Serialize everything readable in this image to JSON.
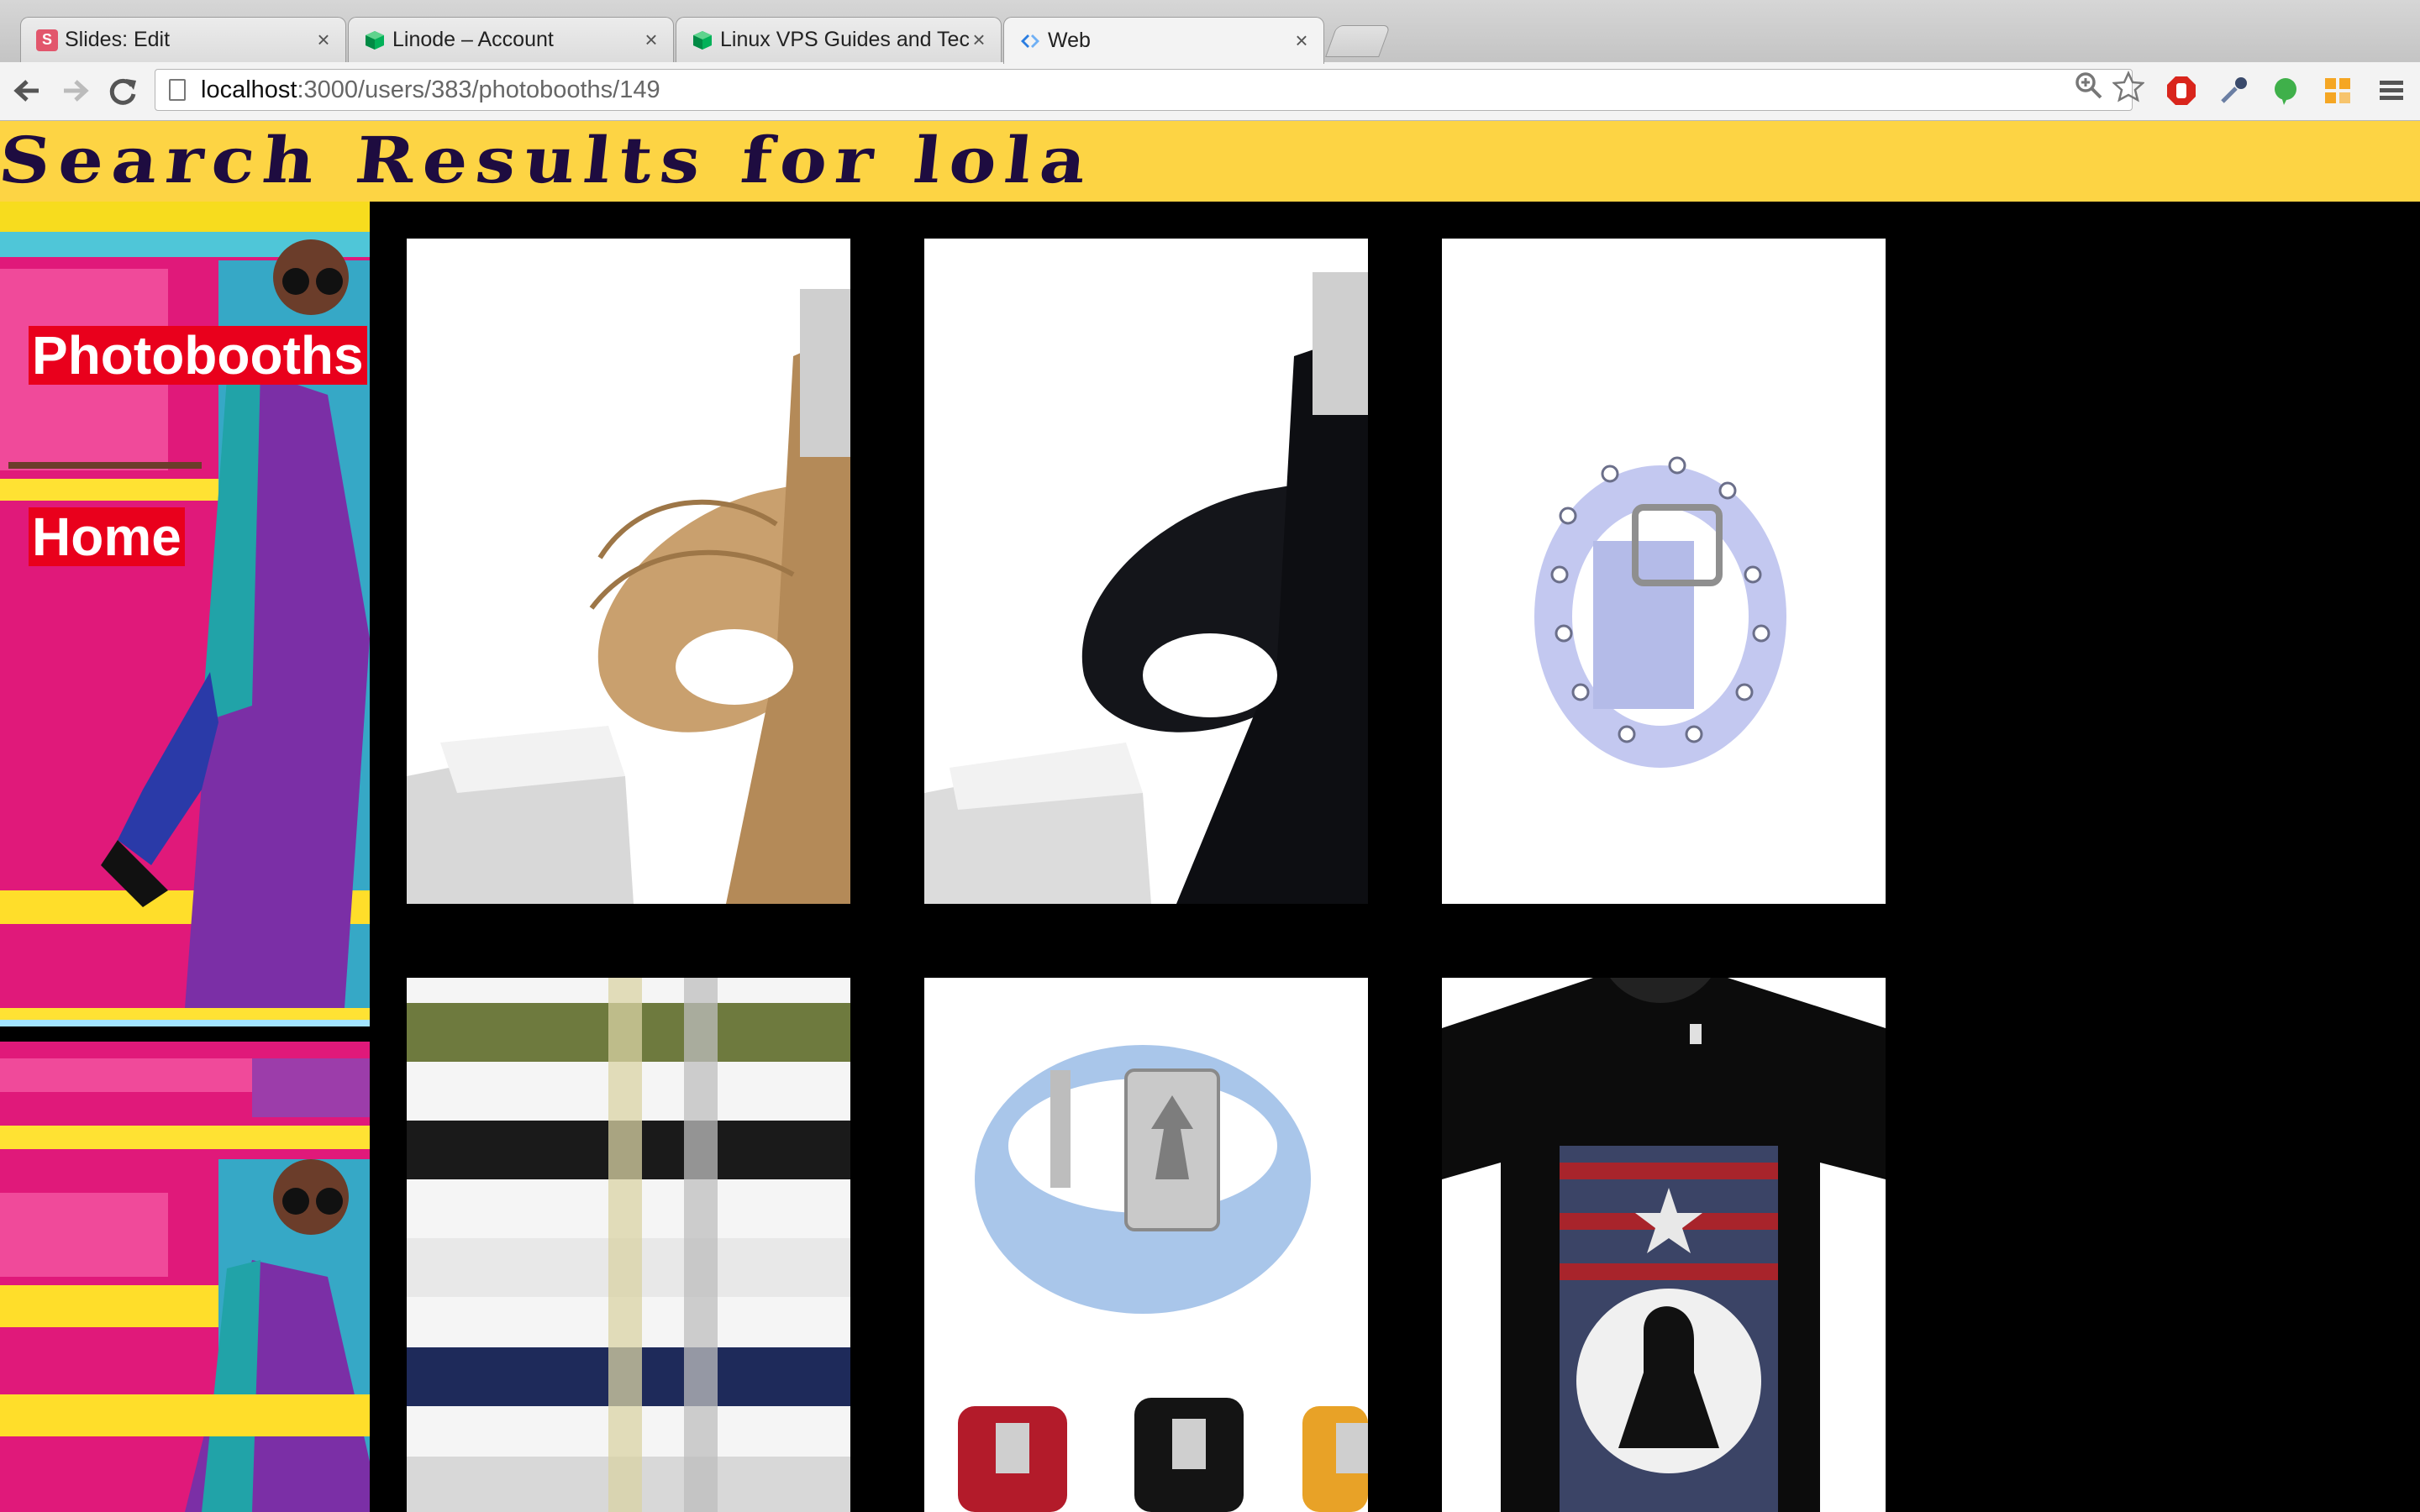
{
  "browser": {
    "tabs": [
      {
        "title": "Slides: Edit",
        "favicon": "slides-icon",
        "favicon_letter": "S",
        "color": "#e2566c"
      },
      {
        "title": "Linode – Account",
        "favicon": "linode-cube-icon",
        "color": "#02b159"
      },
      {
        "title": "Linux VPS Guides and Tech",
        "favicon": "linode-cube-icon",
        "color": "#02b159"
      },
      {
        "title": "Web",
        "favicon": "web-code-icon",
        "color": "#2a7de1",
        "active": true
      }
    ],
    "url_host": "localhost",
    "url_path": ":3000/users/383/photobooths/149",
    "close_glyph": "×"
  },
  "header": {
    "title": "Search Results for lola",
    "bg_color": "#fdd444",
    "text_color": "#1e0c40"
  },
  "sidebar": {
    "links": [
      {
        "label": "Photobooths"
      },
      {
        "label": "Home"
      }
    ],
    "link_bg": "#e9001c"
  },
  "results": [
    {
      "name": "khaki-canvas-belt"
    },
    {
      "name": "black-canvas-belt"
    },
    {
      "name": "lavender-grommet-belt"
    },
    {
      "name": "multicolor-belts"
    },
    {
      "name": "light-blue-eagle-buckle-belt"
    },
    {
      "name": "black-pow-mia-tshirt"
    }
  ]
}
